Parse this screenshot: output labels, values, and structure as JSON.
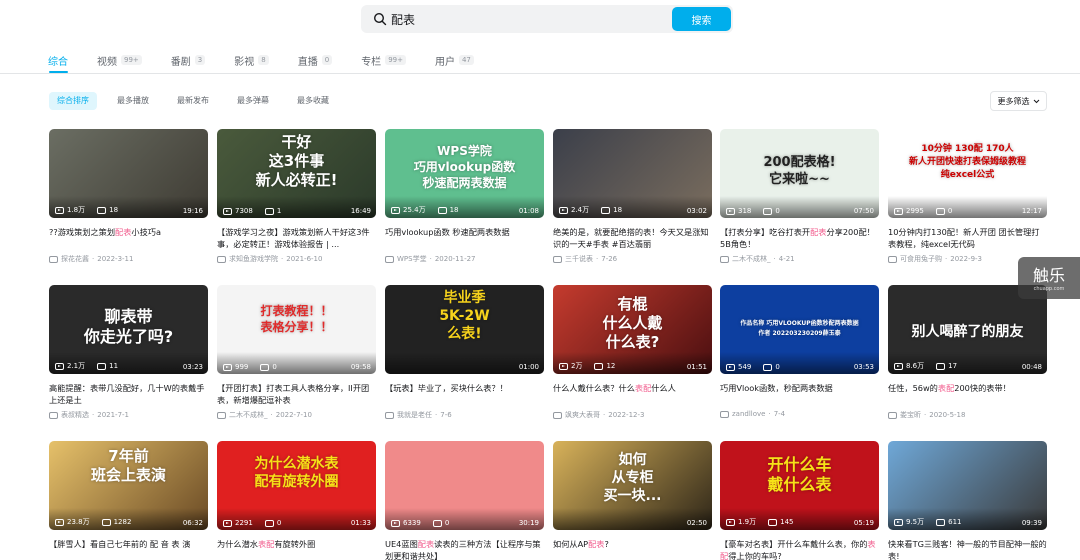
{
  "search": {
    "query": "配表",
    "button": "搜索"
  },
  "tabs": [
    {
      "label": "综合",
      "count": ""
    },
    {
      "label": "视频",
      "count": "99+"
    },
    {
      "label": "番剧",
      "count": "3"
    },
    {
      "label": "影视",
      "count": "8"
    },
    {
      "label": "直播",
      "count": "0"
    },
    {
      "label": "专栏",
      "count": "99+"
    },
    {
      "label": "用户",
      "count": "47"
    }
  ],
  "sorts": [
    "综合排序",
    "最多播放",
    "最新发布",
    "最多弹幕",
    "最多收藏"
  ],
  "filter": "更多筛选",
  "float": {
    "big": "触乐",
    "small": "chuapp.com"
  },
  "videos": [
    {
      "thumb": "",
      "views": "1.8万",
      "danmaku": "18",
      "duration": "19:16",
      "title_pre": "??游戏策划之策划",
      "title_hl": "配表",
      "title_post": "小技巧a",
      "author": "探花花酱",
      "date": "2022-3-11"
    },
    {
      "thumb": "干好\n这3件事\n新人必转正!",
      "views": "7308",
      "danmaku": "1",
      "duration": "16:49",
      "title_pre": "【游戏学习之夜】游戏策划新人干好这3件事，必定转正！游戏体验报告 | ...",
      "title_hl": "",
      "title_post": "",
      "author": "求知鱼游戏学院",
      "date": "2021-6-10"
    },
    {
      "thumb": "WPS学院\n巧用vlookup函数\n秒速配两表数据",
      "views": "25.4万",
      "danmaku": "18",
      "duration": "01:08",
      "title_pre": "巧用vlookup函数 秒速配两表数据",
      "title_hl": "",
      "title_post": "",
      "author": "WPS学堂",
      "date": "2020-11-27"
    },
    {
      "thumb": "",
      "views": "2.4万",
      "danmaku": "18",
      "duration": "03:02",
      "title_pre": "绝美的是，就要配绝搭的表！今天又是涨知识的一天#手表 #百达翡丽",
      "title_hl": "",
      "title_post": "",
      "author": "三千说表",
      "date": "7-26"
    },
    {
      "thumb": "200配表格!\n它来啦~~",
      "views": "318",
      "danmaku": "0",
      "duration": "07:50",
      "title_pre": "【打表分享】吃谷打表开",
      "title_hl": "配表",
      "title_post": "分享200配！5B角色！",
      "author": "二木不成林_",
      "date": "4-21"
    },
    {
      "thumb": "10分钟 130配 170人\n新人开团快速打表保姆级教程\n纯excel公式",
      "views": "2995",
      "danmaku": "0",
      "duration": "12:17",
      "title_pre": "10分钟内打130配！新人开团 团长管理打表教程，纯excel无代码",
      "title_hl": "",
      "title_post": "",
      "author": "可食用兔子购",
      "date": "2022-9-3"
    },
    {
      "thumb": "聊表带\n你走光了吗?",
      "views": "2.1万",
      "danmaku": "11",
      "duration": "03:23",
      "title_pre": "高能提醒：表带几没配好，几十W的表戴手上还是土",
      "title_hl": "",
      "title_post": "",
      "author": "表叔精选",
      "date": "2021-7-1"
    },
    {
      "thumb": "打表教程！！\n表格分享！！",
      "views": "999",
      "danmaku": "0",
      "duration": "09:58",
      "title_pre": "【开团打表】打表工具人表格分享，II开团表，新增爆配逗补表",
      "title_hl": "",
      "title_post": "",
      "author": "二木不成林_",
      "date": "2022-7-10"
    },
    {
      "thumb": "毕业季\n5K-2W\n么表!",
      "views": "",
      "danmaku": "",
      "duration": "01:00",
      "title_pre": "【玩表】毕业了，买块什么表？！",
      "title_hl": "",
      "title_post": "",
      "author": "我就是老任",
      "date": "7-6"
    },
    {
      "thumb": "有棍\n什么人戴\n什么表?",
      "views": "2万",
      "danmaku": "12",
      "duration": "01:51",
      "title_pre": "什么人戴什么表？什么",
      "title_hl": "表配",
      "title_post": "什么人",
      "author": "飒爽大表哥",
      "date": "2022-12-3"
    },
    {
      "thumb": "作品名称 巧用VLOOKUP函数秒配两表数据\n作者 202203230209薛玉泰",
      "views": "549",
      "danmaku": "0",
      "duration": "03:53",
      "title_pre": "巧用Vlook函数，秒配两表数据",
      "title_hl": "",
      "title_post": "",
      "author": "zandllove",
      "date": "7-4"
    },
    {
      "thumb": "别人喝醉了的朋友",
      "views": "8.6万",
      "danmaku": "17",
      "duration": "00:48",
      "title_pre": "任性，56w的",
      "title_hl": "表配",
      "title_post": "200快的表带！",
      "author": "娄宝昕",
      "date": "2020-5-18"
    },
    {
      "thumb": "7年前\n班会上表演",
      "views": "23.8万",
      "danmaku": "1282",
      "duration": "06:32",
      "title_pre": "【胖雪人】看自己七年前的 配 音 表 演",
      "title_hl": "",
      "title_post": "",
      "author": "",
      "date": ""
    },
    {
      "thumb": "为什么潜水表\n配有旋转外圈",
      "views": "2291",
      "danmaku": "0",
      "duration": "01:33",
      "title_pre": "为什么潜水",
      "title_hl": "表配",
      "title_post": "有旋转外圈",
      "author": "",
      "date": ""
    },
    {
      "thumb": "",
      "views": "6339",
      "danmaku": "0",
      "duration": "30:19",
      "title_pre": "UE4蓝图",
      "title_hl": "配表",
      "title_post": "读表的三种方法【让程序与策划更和谐共处】",
      "author": "",
      "date": ""
    },
    {
      "thumb": "如何\n从专柜\n买一块...",
      "views": "",
      "danmaku": "",
      "duration": "02:50",
      "title_pre": "如何从AP",
      "title_hl": "配表",
      "title_post": "?",
      "author": "",
      "date": ""
    },
    {
      "thumb": "开什么车\n戴什么表",
      "views": "1.9万",
      "danmaku": "145",
      "duration": "05:19",
      "title_pre": "【豪车对名表】开什么车戴什么表，你的",
      "title_hl": "表配",
      "title_post": "得上你的车吗?",
      "author": "",
      "date": ""
    },
    {
      "thumb": "",
      "views": "9.5万",
      "danmaku": "611",
      "duration": "09:39",
      "title_pre": "快来看TG三贱客！神一般的节目配神一般的表!",
      "title_hl": "",
      "title_post": "",
      "author": "",
      "date": ""
    }
  ],
  "colors": {
    "accent": "#00aeec",
    "highlight": "#f25d8e"
  }
}
